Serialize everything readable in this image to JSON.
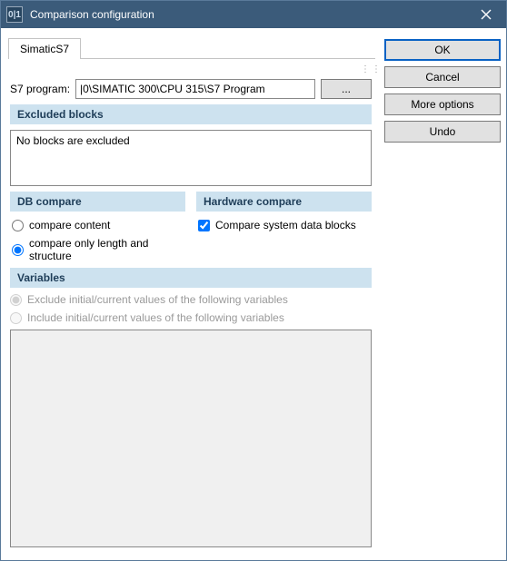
{
  "window": {
    "title": "Comparison configuration",
    "app_icon_text": "0|1"
  },
  "buttons": {
    "ok": "OK",
    "cancel": "Cancel",
    "more_options": "More options",
    "undo": "Undo",
    "browse": "..."
  },
  "tabs": {
    "simatic": "SimaticS7"
  },
  "s7": {
    "label": "S7 program:",
    "value": "|0\\SIMATIC 300\\CPU 315\\S7 Program"
  },
  "groups": {
    "excluded_blocks": "Excluded blocks",
    "db_compare": "DB compare",
    "hardware_compare": "Hardware compare",
    "variables": "Variables"
  },
  "excluded": {
    "text": "No blocks are excluded"
  },
  "db": {
    "compare_content": "compare content",
    "compare_length": "compare only length and structure"
  },
  "hw": {
    "compare_sdb": "Compare system data blocks"
  },
  "vars": {
    "exclude": "Exclude initial/current values of the following variables",
    "include": "Include initial/current values of the following variables"
  }
}
